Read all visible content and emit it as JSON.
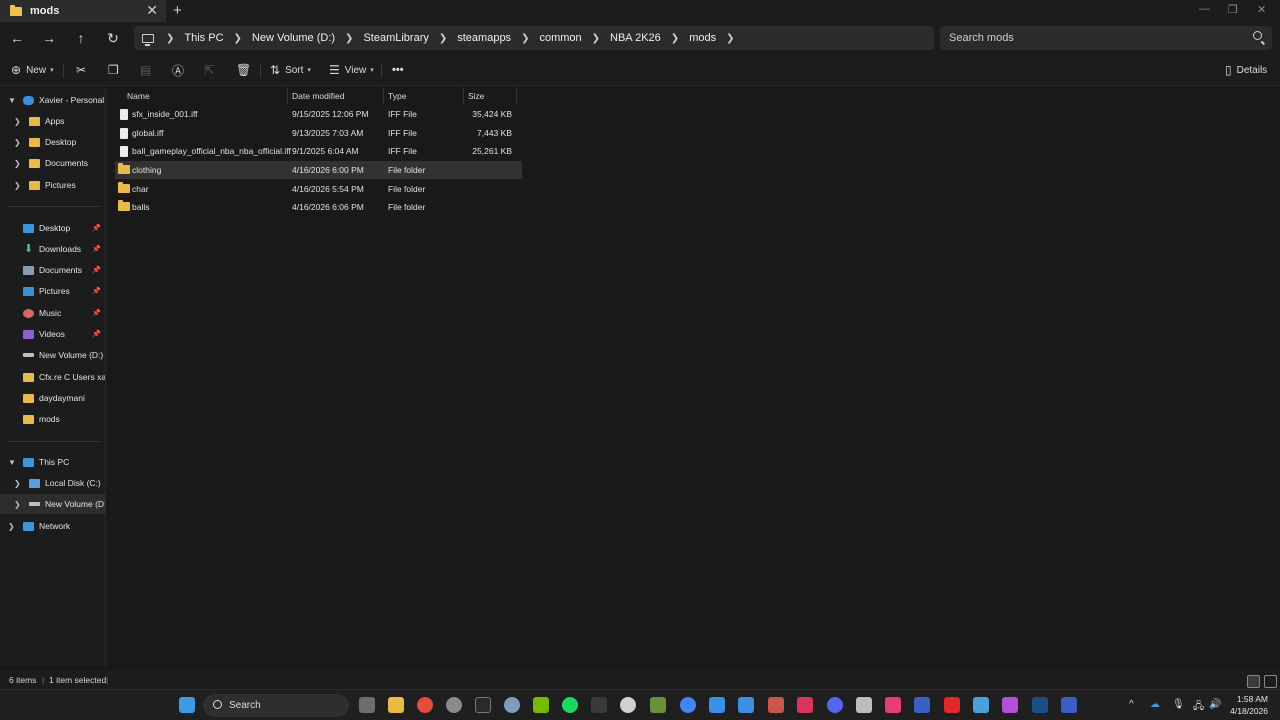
{
  "window": {
    "tab_title": "mods",
    "new_tab": "+"
  },
  "breadcrumb": [
    "This PC",
    "New Volume (D:)",
    "SteamLibrary",
    "steamapps",
    "common",
    "NBA 2K26",
    "mods"
  ],
  "search": {
    "placeholder": "Search mods"
  },
  "toolbar": {
    "new_label": "New",
    "sort_label": "Sort",
    "view_label": "View",
    "more_label": "•••",
    "details_label": "Details"
  },
  "sidebar": {
    "home": "Xavier - Personal",
    "cloud_items": [
      "Apps",
      "Desktop",
      "Documents",
      "Pictures"
    ],
    "quick_access": [
      {
        "label": "Desktop",
        "pinned": true
      },
      {
        "label": "Downloads",
        "pinned": true
      },
      {
        "label": "Documents",
        "pinned": true
      },
      {
        "label": "Pictures",
        "pinned": true
      },
      {
        "label": "Music",
        "pinned": true
      },
      {
        "label": "Videos",
        "pinned": true
      },
      {
        "label": "New Volume (D:)",
        "pinned": false
      },
      {
        "label": "Cfx.re  C  Users xavi",
        "pinned": false
      },
      {
        "label": "daydaymani",
        "pinned": false
      },
      {
        "label": "mods",
        "pinned": false
      }
    ],
    "this_pc": "This PC",
    "drives": [
      "Local Disk (C:)",
      "New Volume (D:)"
    ],
    "network": "Network"
  },
  "columns": {
    "name": "Name",
    "date": "Date modified",
    "type": "Type",
    "size": "Size"
  },
  "files": [
    {
      "name": "sfx_inside_001.iff",
      "date": "9/15/2025 12:06 PM",
      "type": "IFF File",
      "size": "35,424 KB",
      "kind": "file"
    },
    {
      "name": "global.iff",
      "date": "9/13/2025 7:03 AM",
      "type": "IFF File",
      "size": "7,443 KB",
      "kind": "file"
    },
    {
      "name": "ball_gameplay_official_nba_nba_official.iff",
      "date": "9/1/2025 6:04 AM",
      "type": "IFF File",
      "size": "25,261 KB",
      "kind": "file"
    },
    {
      "name": "clothing",
      "date": "4/16/2026 6:00 PM",
      "type": "File folder",
      "size": "",
      "kind": "folder"
    },
    {
      "name": "char",
      "date": "4/16/2026 5:54 PM",
      "type": "File folder",
      "size": "",
      "kind": "folder"
    },
    {
      "name": "balls",
      "date": "4/16/2026 6:06 PM",
      "type": "File folder",
      "size": "",
      "kind": "folder"
    }
  ],
  "status": {
    "item_count": "6 items",
    "selection": "1 item selected"
  },
  "taskbar": {
    "search_label": "Search",
    "time": "1:58 AM",
    "date": "4/18/2026"
  },
  "colors": {
    "background": "#191919",
    "chrome": "#1c1c1c",
    "folder": "#e9b949",
    "selection": "#323232"
  }
}
